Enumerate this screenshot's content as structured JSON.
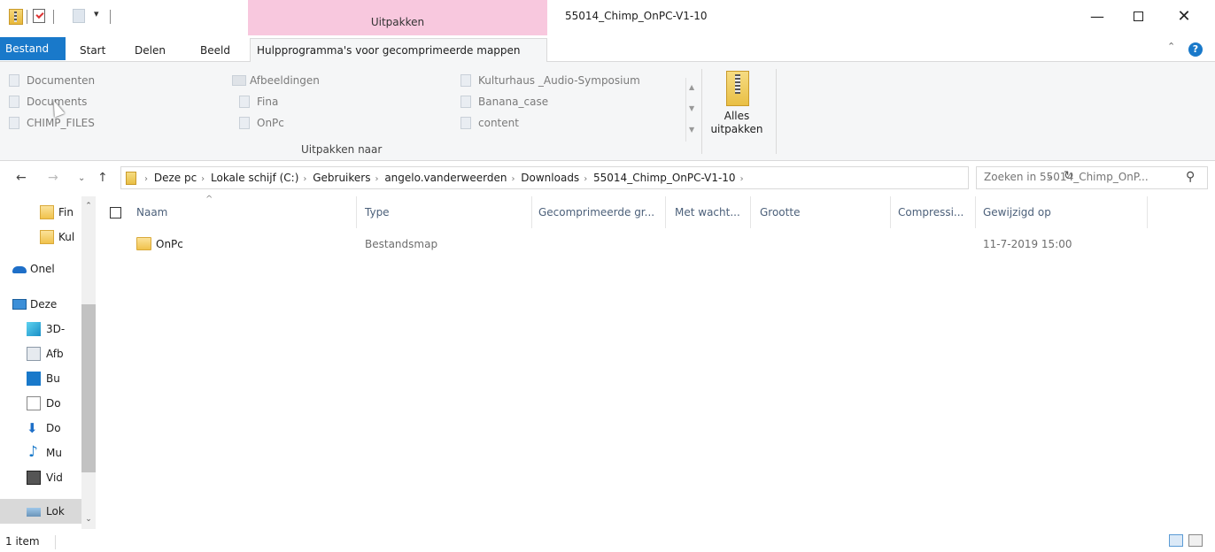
{
  "window": {
    "context_tab_header": "Uitpakken",
    "title": "55014_Chimp_OnPC-V1-10",
    "minimize_glyph": "—",
    "close_glyph": "✕"
  },
  "ribbon": {
    "tabs": {
      "file": "Bestand",
      "start": "Start",
      "share": "Delen",
      "view": "Beeld",
      "tools": "Hulpprogramma's voor gecomprimeerde mappen"
    },
    "destinations": [
      {
        "label": "Documenten",
        "icon": "document-icon"
      },
      {
        "label": "Documents",
        "icon": "blank-file-icon"
      },
      {
        "label": "CHIMP_FILES",
        "icon": "blank-file-icon"
      },
      {
        "label": "Afbeeldingen",
        "icon": "pictures-icon"
      },
      {
        "label": "Fina",
        "icon": "blank-file-icon"
      },
      {
        "label": "OnPc",
        "icon": "blank-file-icon"
      },
      {
        "label": "Kulturhaus _Audio-Symposium",
        "icon": "blank-file-icon"
      },
      {
        "label": "Banana_case",
        "icon": "blank-file-icon"
      },
      {
        "label": "content",
        "icon": "blank-file-icon"
      }
    ],
    "destinations_group_label": "Uitpakken naar",
    "extract_all_label": "Alles uitpakken"
  },
  "address": {
    "crumbs": [
      "Deze pc",
      "Lokale schijf (C:)",
      "Gebruikers",
      "angelo.vanderweerden",
      "Downloads",
      "55014_Chimp_OnPC-V1-10"
    ],
    "search_placeholder": "Zoeken in 55014_Chimp_OnP..."
  },
  "nav_pane": {
    "items": [
      {
        "label": "Fin",
        "icon": "folder-icon"
      },
      {
        "label": "Kul",
        "icon": "folder-icon"
      },
      {
        "label": "Onel",
        "icon": "onedrive-icon"
      },
      {
        "label": "Deze",
        "icon": "this-pc-icon"
      },
      {
        "label": "3D-",
        "icon": "3d-objects-icon"
      },
      {
        "label": "Afb",
        "icon": "pictures-icon"
      },
      {
        "label": "Bu",
        "icon": "desktop-icon"
      },
      {
        "label": "Do",
        "icon": "documents-icon"
      },
      {
        "label": "Do",
        "icon": "downloads-icon"
      },
      {
        "label": "Mu",
        "icon": "music-icon"
      },
      {
        "label": "Vid",
        "icon": "videos-icon"
      },
      {
        "label": "Lok",
        "icon": "local-disk-icon",
        "selected": true
      }
    ]
  },
  "file_list": {
    "columns": [
      "Naam",
      "Type",
      "Gecomprimeerde gr...",
      "Met wacht...",
      "Grootte",
      "Compressi...",
      "Gewijzigd op"
    ],
    "rows": [
      {
        "name": "OnPc",
        "type": "Bestandsmap",
        "compressed_size": "",
        "password": "",
        "size": "",
        "compression": "",
        "modified": "11-7-2019 15:00"
      }
    ]
  },
  "status": {
    "item_count": "1 item"
  }
}
